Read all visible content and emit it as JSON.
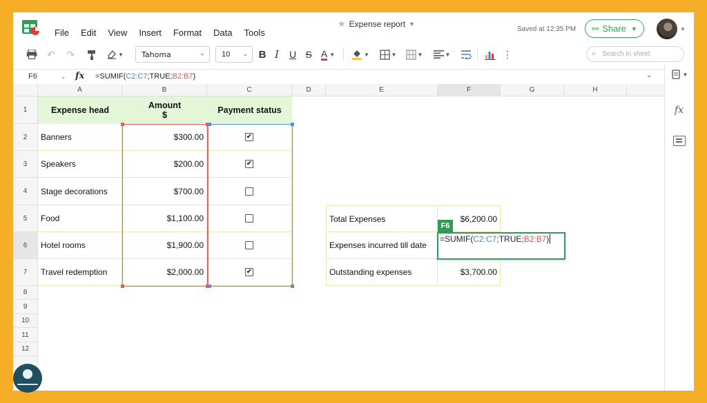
{
  "menu": [
    "File",
    "Edit",
    "View",
    "Insert",
    "Format",
    "Data",
    "Tools"
  ],
  "document": {
    "title": "Expense report",
    "saved_status": "Saved at 12:35 PM"
  },
  "share": {
    "label": "Share"
  },
  "toolbar": {
    "font": "Tahoma",
    "font_size": "10",
    "bold": "B",
    "italic": "I",
    "underline": "U",
    "strike": "S",
    "text_color": "A"
  },
  "search": {
    "placeholder": "Search in sheet"
  },
  "formula_bar": {
    "cell_ref": "F6",
    "fx": "fx",
    "parts": [
      "=SUMIF(",
      "C2:C7",
      ";TRUE;",
      "B2:B7",
      ")"
    ]
  },
  "columns": [
    "A",
    "B",
    "C",
    "D",
    "E",
    "F",
    "G",
    "H"
  ],
  "rows": [
    "1",
    "2",
    "3",
    "4",
    "5",
    "6",
    "7",
    "8",
    "9",
    "10",
    "11",
    "12"
  ],
  "table": {
    "headers": {
      "expense_head": "Expense head",
      "amount_line1": "Amount",
      "amount_line2": "$",
      "payment_status": "Payment status"
    },
    "items": [
      {
        "name": "Banners",
        "amount": "$300.00",
        "paid": true
      },
      {
        "name": "Speakers",
        "amount": "$200.00",
        "paid": true
      },
      {
        "name": "Stage decorations",
        "amount": "$700.00",
        "paid": false
      },
      {
        "name": "Food",
        "amount": "$1,100.00",
        "paid": false
      },
      {
        "name": "Hotel rooms",
        "amount": "$1,900.00",
        "paid": false
      },
      {
        "name": "Travel redemption",
        "amount": "$2,000.00",
        "paid": true
      }
    ]
  },
  "summary": {
    "total_label": "Total Expenses",
    "total_value": "$6,200.00",
    "incurred_label": "Expenses incurred till date",
    "outstanding_label": "Outstanding expenses",
    "outstanding_value": "$3,700.00"
  },
  "editor": {
    "tag": "F6"
  },
  "check_glyph": "✔",
  "colors": {
    "accent": "#2e9d55",
    "header_fill": "#e3f6d8",
    "border_frame": "#f6ae27",
    "range_red": "#e06060",
    "range_blue": "#5b8ee6"
  }
}
